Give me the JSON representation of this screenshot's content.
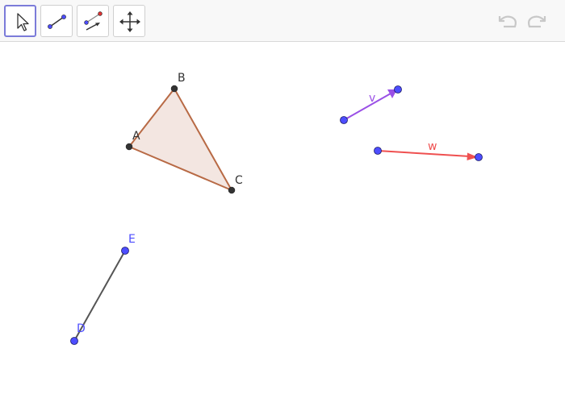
{
  "toolbar": {
    "tools": [
      {
        "name": "move-tool",
        "icon": "cursor-arrow-icon",
        "active": true
      },
      {
        "name": "segment-tool",
        "icon": "segment-icon",
        "active": false
      },
      {
        "name": "vector-tool",
        "icon": "vector-icon",
        "active": false
      },
      {
        "name": "move-graphics-view-tool",
        "icon": "move-arrows-icon",
        "active": false
      }
    ],
    "undo_icon": "undo-icon",
    "redo_icon": "redo-icon"
  },
  "colors": {
    "triangle_stroke": "#b86a45",
    "triangle_fill": "#f3e6e1",
    "vector_v": "#9a50e6",
    "vector_w": "#ef5050",
    "segment": "#555555",
    "free_point": "#4d4dff",
    "dependent_point": "#333333",
    "free_label": "#4d4dff",
    "dark_label": "#333333"
  },
  "geometry": {
    "triangle": {
      "points": [
        {
          "label": "A"
        },
        {
          "label": "B"
        },
        {
          "label": "C"
        }
      ]
    },
    "vector_v": {
      "label": "v"
    },
    "vector_w": {
      "label": "w"
    },
    "segment": {
      "start": {
        "label": "D"
      },
      "end": {
        "label": "E"
      }
    }
  }
}
